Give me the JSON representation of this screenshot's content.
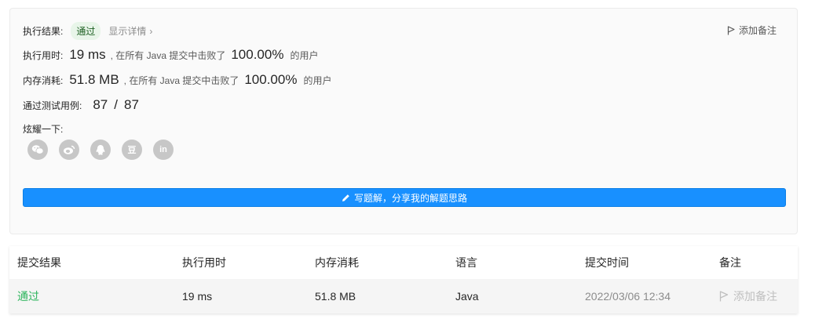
{
  "result": {
    "label": "执行结果:",
    "status": "通过",
    "details": "显示详情",
    "details_chevron": "›",
    "add_note": "添加备注",
    "runtime": {
      "label": "执行用时:",
      "value": "19 ms",
      "middle": ", 在所有 Java 提交中击败了",
      "percent": "100.00%",
      "suffix": "的用户"
    },
    "memory": {
      "label": "内存消耗:",
      "value": "51.8 MB",
      "middle": ", 在所有 Java 提交中击败了",
      "percent": "100.00%",
      "suffix": "的用户"
    },
    "testcases": {
      "label": "通过测试用例:",
      "passed": "87",
      "separator": "/",
      "total": "87"
    },
    "share": {
      "label": "炫耀一下:",
      "icons": [
        "wechat-icon",
        "weibo-icon",
        "qq-icon",
        "douban-icon",
        "linkedin-icon"
      ],
      "douban_glyph": "豆",
      "linkedin_glyph": "in"
    },
    "write_solution": "写题解，分享我的解题思路"
  },
  "submissions": {
    "headers": [
      "提交结果",
      "执行用时",
      "内存消耗",
      "语言",
      "提交时间",
      "备注"
    ],
    "rows": [
      {
        "status": "通过",
        "runtime": "19 ms",
        "memory": "51.8 MB",
        "language": "Java",
        "time": "2022/03/06 12:34",
        "note": "添加备注"
      }
    ]
  },
  "colors": {
    "accent": "#1890ff",
    "pass": "#2db55d",
    "badge_bg": "#e8f5e9",
    "icon_gray": "#c7c7c7"
  }
}
